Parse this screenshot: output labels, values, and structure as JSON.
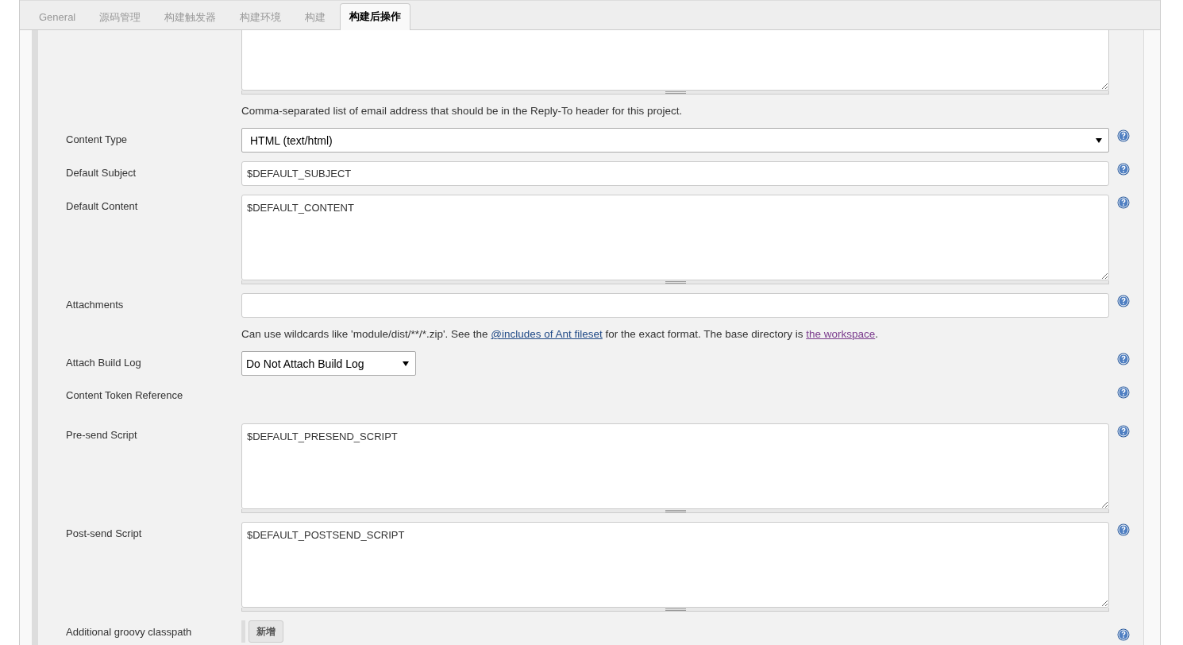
{
  "tabs": [
    {
      "label": "General",
      "selected": false
    },
    {
      "label": "源码管理",
      "selected": false
    },
    {
      "label": "构建触发器",
      "selected": false
    },
    {
      "label": "构建环境",
      "selected": false
    },
    {
      "label": "构建",
      "selected": false
    },
    {
      "label": "构建后操作",
      "selected": true
    }
  ],
  "rows": [
    {
      "kind": "textarea",
      "cut": true,
      "help_icon": false
    },
    {
      "kind": "note",
      "parts": [
        {
          "text": "Comma-separated list of email address that should be in the Reply-To header for this project."
        }
      ]
    },
    {
      "kind": "select",
      "label": "Content Type",
      "value": "HTML (text/html)",
      "wide": true,
      "help_icon": true
    },
    {
      "kind": "text",
      "label": "Default Subject",
      "value": "$DEFAULT_SUBJECT",
      "help_icon": true
    },
    {
      "kind": "textarea",
      "label": "Default Content",
      "value": "$DEFAULT_CONTENT",
      "cut": false,
      "help_icon": true
    },
    {
      "kind": "text",
      "label": "Attachments",
      "value": "",
      "help_icon": true
    },
    {
      "kind": "note",
      "parts": [
        {
          "text": "Can use wildcards like 'module/dist/**/*.zip'. See the "
        },
        {
          "text": "@includes of Ant fileset",
          "link": true,
          "visited": false
        },
        {
          "text": " for the exact format. The base directory is "
        },
        {
          "text": "the workspace",
          "link": true,
          "visited": true
        },
        {
          "text": "."
        }
      ]
    },
    {
      "kind": "select",
      "label": "Attach Build Log",
      "value": "Do Not Attach Build Log",
      "wide": false,
      "help_icon": true
    },
    {
      "kind": "plain",
      "label": "Content Token Reference",
      "help_icon": true
    },
    {
      "kind": "textarea",
      "label": "Pre-send Script",
      "value": "$DEFAULT_PRESEND_SCRIPT",
      "cut": false,
      "help_icon": true
    },
    {
      "kind": "textarea",
      "label": "Post-send Script",
      "value": "$DEFAULT_POSTSEND_SCRIPT",
      "cut": false,
      "help_icon": true
    },
    {
      "kind": "button",
      "label": "Additional groovy classpath",
      "button": "新增",
      "help_icon": true
    }
  ]
}
